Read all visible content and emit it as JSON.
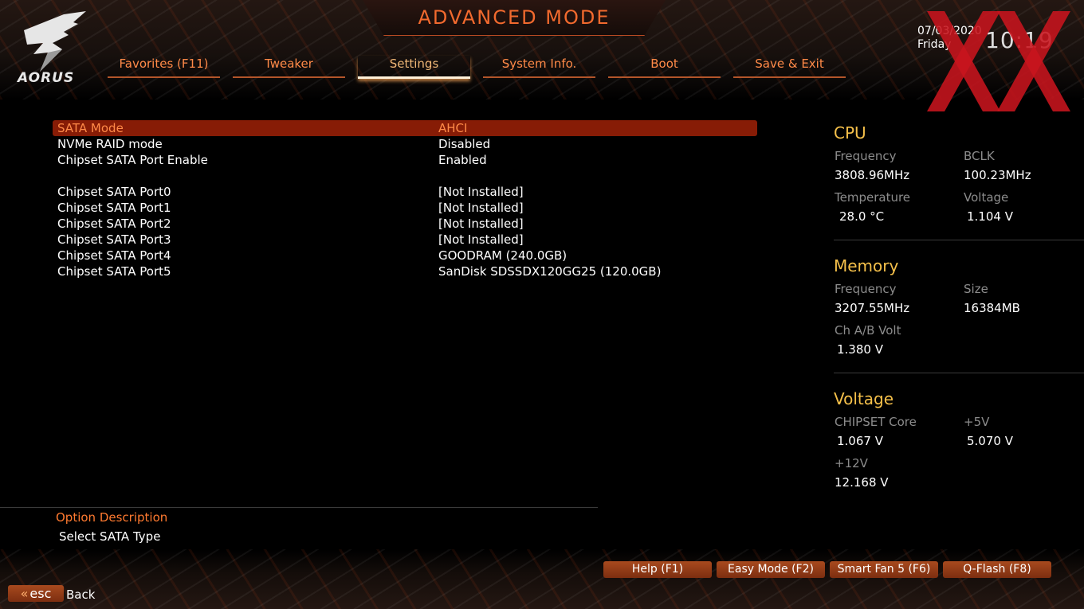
{
  "header": {
    "title": "ADVANCED MODE",
    "logo_text": "AORUS",
    "date": "07/03/2020",
    "day": "Friday",
    "time": "10:19"
  },
  "tabs": [
    {
      "label": "Favorites (F11)",
      "active": false
    },
    {
      "label": "Tweaker",
      "active": false
    },
    {
      "label": "Settings",
      "active": true
    },
    {
      "label": "System Info.",
      "active": false
    },
    {
      "label": "Boot",
      "active": false
    },
    {
      "label": "Save & Exit",
      "active": false
    }
  ],
  "settings": {
    "group1": [
      {
        "label": "SATA Mode",
        "value": "AHCI"
      },
      {
        "label": "NVMe RAID mode",
        "value": "Disabled"
      },
      {
        "label": "Chipset SATA Port Enable",
        "value": "Enabled"
      }
    ],
    "group2": [
      {
        "label": "Chipset SATA Port0",
        "value": "[Not Installed]"
      },
      {
        "label": "Chipset SATA Port1",
        "value": "[Not Installed]"
      },
      {
        "label": "Chipset SATA Port2",
        "value": "[Not Installed]"
      },
      {
        "label": "Chipset SATA Port3",
        "value": "[Not Installed]"
      },
      {
        "label": "Chipset SATA Port4",
        "value": "GOODRAM (240.0GB)"
      },
      {
        "label": "Chipset SATA Port5",
        "value": "SanDisk SDSSDX120GG25 (120.0GB)"
      }
    ]
  },
  "cpu": {
    "title": "CPU",
    "frequency_label": "Frequency",
    "frequency": "3808.96MHz",
    "bclk_label": "BCLK",
    "bclk": "100.23MHz",
    "temperature_label": "Temperature",
    "temperature": "28.0 °C",
    "voltage_label": "Voltage",
    "voltage": "1.104 V"
  },
  "memory": {
    "title": "Memory",
    "frequency_label": "Frequency",
    "frequency": "3207.55MHz",
    "size_label": "Size",
    "size": "16384MB",
    "volt_label": "Ch A/B Volt",
    "volt": "1.380 V"
  },
  "voltage": {
    "title": "Voltage",
    "chipset_label": "CHIPSET Core",
    "chipset": "1.067 V",
    "v5_label": "+5V",
    "v5": "5.070 V",
    "v12_label": "+12V",
    "v12": "12.168 V"
  },
  "description": {
    "title": "Option Description",
    "text": "Select SATA Type"
  },
  "footer": {
    "help": "Help (F1)",
    "easy": "Easy Mode (F2)",
    "fan": "Smart Fan 5 (F6)",
    "qflash": "Q-Flash (F8)",
    "esc_chevron": "«",
    "esc": "esc",
    "back": "Back"
  },
  "colors": {
    "accent": "#ff8a48",
    "selected_row": "#871c06",
    "section_title": "#f5c04a",
    "watermark": "#c8141e"
  }
}
